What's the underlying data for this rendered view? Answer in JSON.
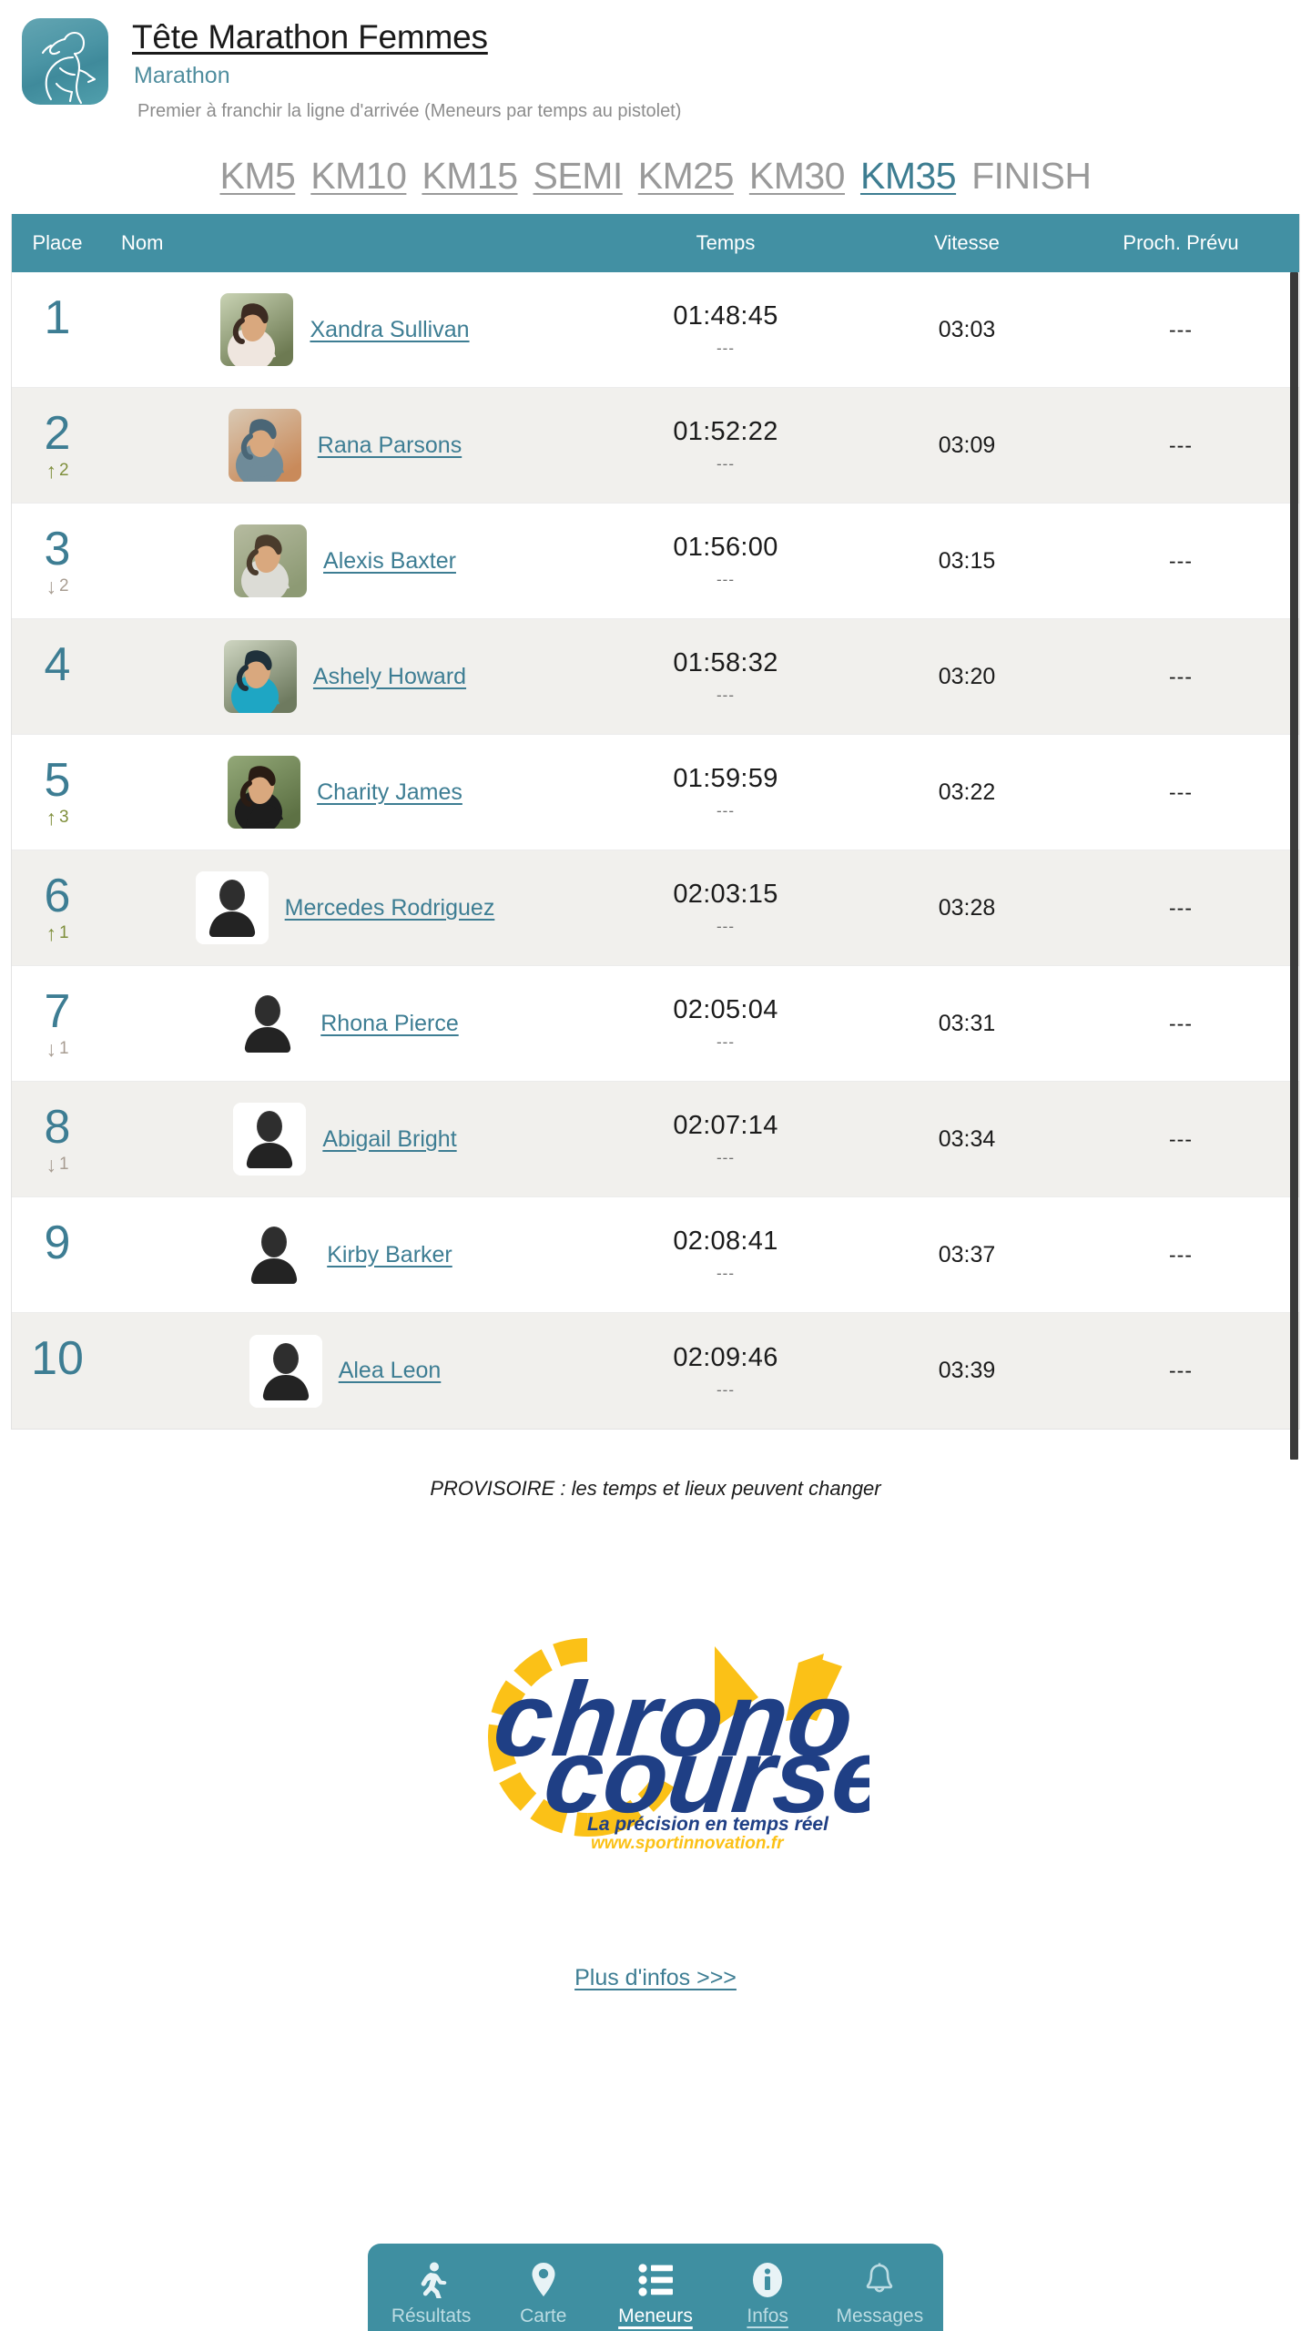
{
  "header": {
    "app_icon_name": "woman-runner-icon",
    "title": "Tête Marathon Femmes",
    "subtitle": "Marathon",
    "note": "Premier à franchir la ligne d'arrivée (Meneurs par temps au pistolet)",
    "accent_color": "#4290a3"
  },
  "splits": [
    {
      "label": "KM5",
      "active": false,
      "underlined": true
    },
    {
      "label": "KM10",
      "active": false,
      "underlined": true
    },
    {
      "label": "KM15",
      "active": false,
      "underlined": true
    },
    {
      "label": "SEMI",
      "active": false,
      "underlined": true
    },
    {
      "label": "KM25",
      "active": false,
      "underlined": true
    },
    {
      "label": "KM30",
      "active": false,
      "underlined": true
    },
    {
      "label": "KM35",
      "active": true,
      "underlined": true
    },
    {
      "label": "FINISH",
      "active": false,
      "underlined": false
    }
  ],
  "table": {
    "headers": {
      "place": "Place",
      "name": "Nom",
      "time": "Temps",
      "speed": "Vitesse",
      "next": "Proch. Prévu"
    },
    "rows": [
      {
        "place": "1",
        "delta": "",
        "delta_dir": "none",
        "name": "Xandra Sullivan",
        "avatar": "photo-woman-white-tank",
        "time": "01:48:45",
        "time_sub": "---",
        "speed": "03:03",
        "next": "---"
      },
      {
        "place": "2",
        "delta": "2",
        "delta_dir": "up",
        "name": "Rana Parsons",
        "avatar": "photo-woman-blue-top",
        "time": "01:52:22",
        "time_sub": "---",
        "speed": "03:09",
        "next": "---"
      },
      {
        "place": "3",
        "delta": "2",
        "delta_dir": "down",
        "name": "Alexis Baxter",
        "avatar": "photo-woman-grey-top",
        "time": "01:56:00",
        "time_sub": "---",
        "speed": "03:15",
        "next": "---"
      },
      {
        "place": "4",
        "delta": "",
        "delta_dir": "none",
        "name": "Ashely Howard",
        "avatar": "photo-woman-teal-vest",
        "time": "01:58:32",
        "time_sub": "---",
        "speed": "03:20",
        "next": "---"
      },
      {
        "place": "5",
        "delta": "3",
        "delta_dir": "up",
        "name": "Charity James",
        "avatar": "photo-woman-black-top",
        "time": "01:59:59",
        "time_sub": "---",
        "speed": "03:22",
        "next": "---"
      },
      {
        "place": "6",
        "delta": "1",
        "delta_dir": "up",
        "name": "Mercedes Rodriguez",
        "avatar": "silhouette",
        "time": "02:03:15",
        "time_sub": "---",
        "speed": "03:28",
        "next": "---"
      },
      {
        "place": "7",
        "delta": "1",
        "delta_dir": "down",
        "name": "Rhona Pierce",
        "avatar": "silhouette",
        "time": "02:05:04",
        "time_sub": "---",
        "speed": "03:31",
        "next": "---"
      },
      {
        "place": "8",
        "delta": "1",
        "delta_dir": "down",
        "name": "Abigail Bright",
        "avatar": "silhouette",
        "time": "02:07:14",
        "time_sub": "---",
        "speed": "03:34",
        "next": "---"
      },
      {
        "place": "9",
        "delta": "",
        "delta_dir": "none",
        "name": "Kirby Barker",
        "avatar": "silhouette",
        "time": "02:08:41",
        "time_sub": "---",
        "speed": "03:37",
        "next": "---"
      },
      {
        "place": "10",
        "delta": "",
        "delta_dir": "none",
        "name": "Alea Leon",
        "avatar": "silhouette",
        "time": "02:09:46",
        "time_sub": "---",
        "speed": "03:39",
        "next": "---"
      }
    ]
  },
  "notice": "PROVISOIRE : les temps et lieux peuvent changer",
  "logo": {
    "name": "chronocourse-logo",
    "word_top": "chrono",
    "word_bottom": "course",
    "tagline": "La précision en temps réel",
    "website": "www.sportinnovation.fr",
    "blue": "#1f3f85",
    "yellow": "#fbc117"
  },
  "more_link": "Plus d'infos >>>",
  "bottom_nav": [
    {
      "label": "Résultats",
      "icon": "runner-icon",
      "active": false,
      "underlined": false
    },
    {
      "label": "Carte",
      "icon": "map-pin-icon",
      "active": false,
      "underlined": false
    },
    {
      "label": "Meneurs",
      "icon": "list-icon",
      "active": true,
      "underlined": true
    },
    {
      "label": "Infos",
      "icon": "info-icon",
      "active": false,
      "underlined": true
    },
    {
      "label": "Messages",
      "icon": "bell-icon",
      "active": false,
      "underlined": false
    }
  ]
}
